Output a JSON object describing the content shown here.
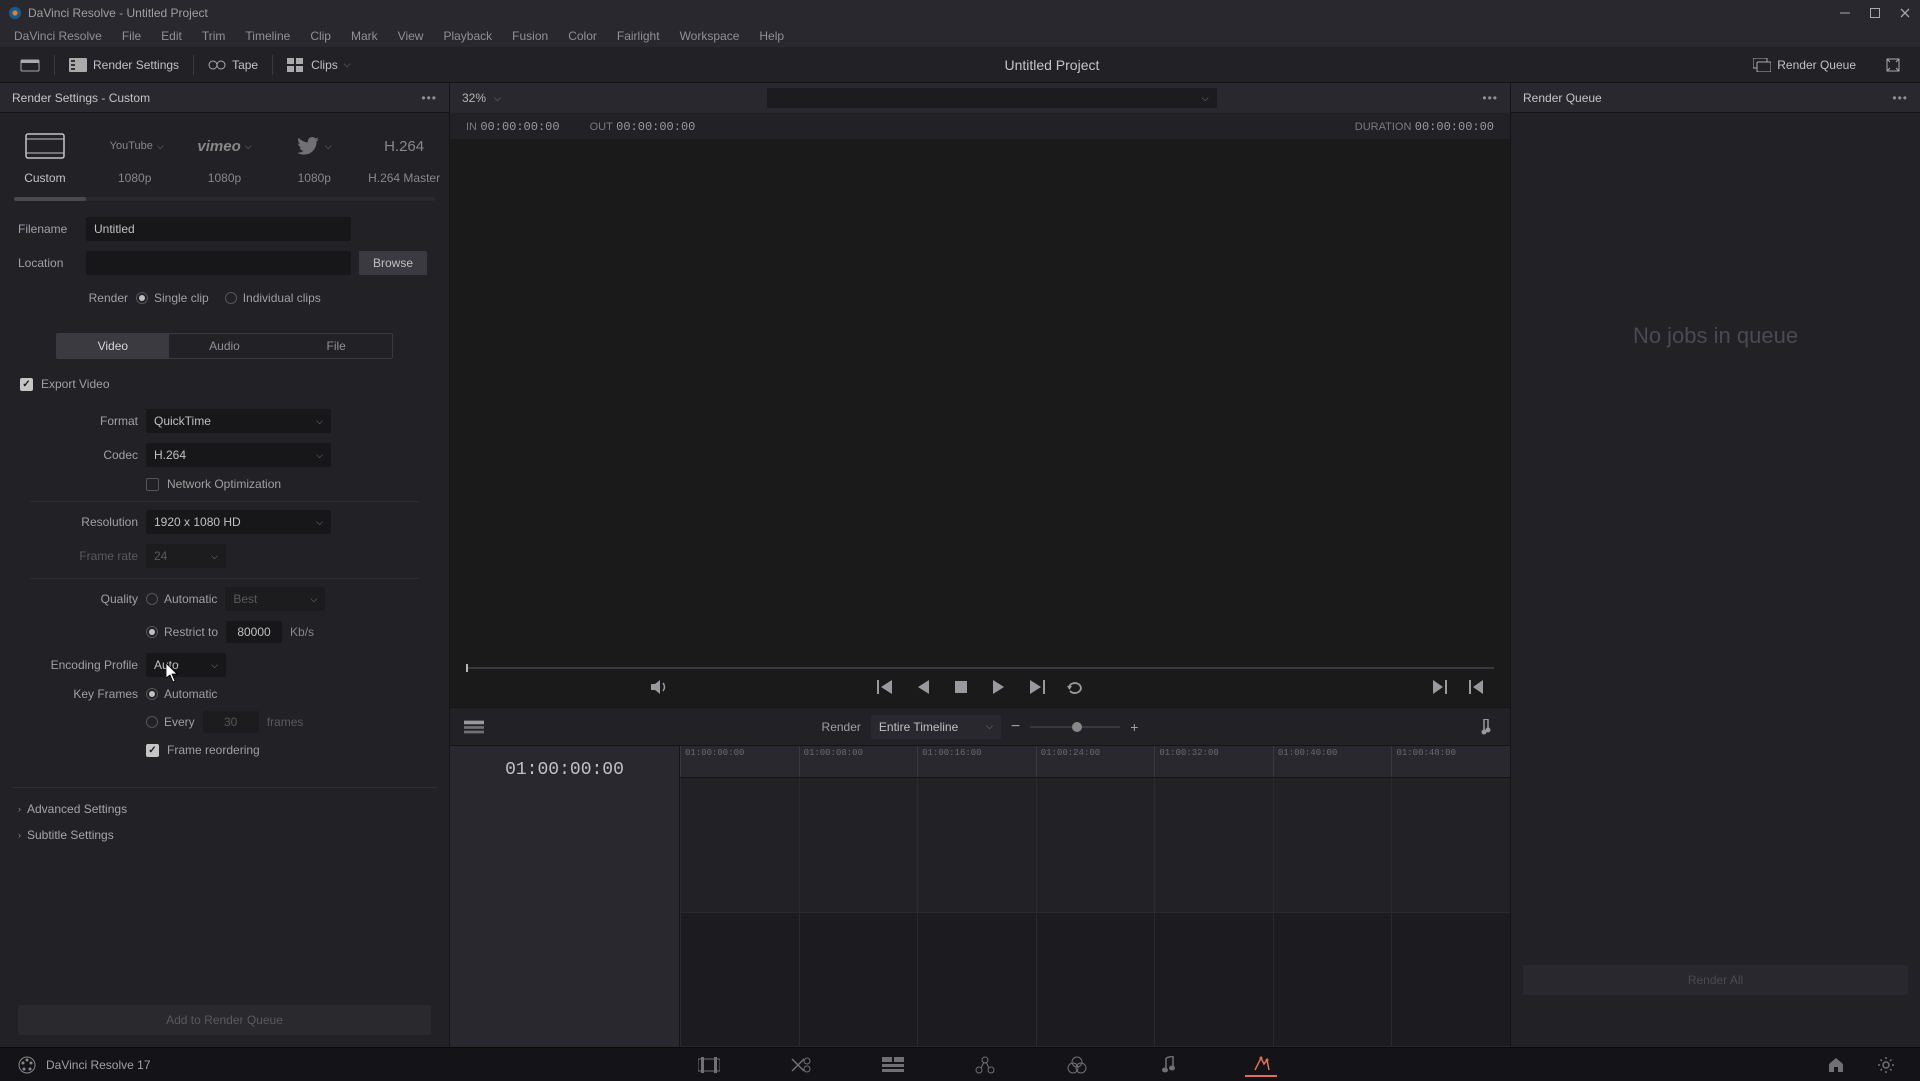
{
  "window": {
    "title": "DaVinci Resolve - Untitled Project"
  },
  "menu": [
    "DaVinci Resolve",
    "File",
    "Edit",
    "Trim",
    "Timeline",
    "Clip",
    "Mark",
    "View",
    "Playback",
    "Fusion",
    "Color",
    "Fairlight",
    "Workspace",
    "Help"
  ],
  "toolbar": {
    "render_settings": "Render Settings",
    "tape": "Tape",
    "clips": "Clips",
    "project_title": "Untitled Project",
    "render_queue": "Render Queue"
  },
  "left": {
    "header": "Render Settings - Custom",
    "presets": [
      {
        "key": "custom",
        "label": "Custom"
      },
      {
        "key": "youtube",
        "label": "1080p",
        "brand": "YouTube"
      },
      {
        "key": "vimeo",
        "label": "1080p",
        "brand": "vimeo"
      },
      {
        "key": "twitter",
        "label": "1080p"
      },
      {
        "key": "h264",
        "label": "H.264 Master",
        "brand": "H.264"
      }
    ],
    "filename_label": "Filename",
    "filename_value": "Untitled",
    "location_label": "Location",
    "location_value": "",
    "browse": "Browse",
    "render_label": "Render",
    "render_single": "Single clip",
    "render_individual": "Individual clips",
    "tabs": {
      "video": "Video",
      "audio": "Audio",
      "file": "File"
    },
    "export_video": "Export Video",
    "format_label": "Format",
    "format_value": "QuickTime",
    "codec_label": "Codec",
    "codec_value": "H.264",
    "network_opt": "Network Optimization",
    "resolution_label": "Resolution",
    "resolution_value": "1920 x 1080 HD",
    "framerate_label": "Frame rate",
    "framerate_value": "24",
    "quality_label": "Quality",
    "quality_auto": "Automatic",
    "quality_best": "Best",
    "quality_restrict": "Restrict to",
    "quality_bitrate": "80000",
    "quality_unit": "Kb/s",
    "encoding_label": "Encoding Profile",
    "encoding_value": "Auto",
    "keyframes_label": "Key Frames",
    "keyframes_auto": "Automatic",
    "keyframes_every": "Every",
    "keyframes_num": "30",
    "keyframes_unit": "frames",
    "frame_reorder": "Frame reordering",
    "advanced": "Advanced Settings",
    "subtitle": "Subtitle Settings",
    "add_to_queue": "Add to Render Queue"
  },
  "viewer": {
    "zoom": "32%",
    "in_label": "IN",
    "in_val": "00:00:00:00",
    "out_label": "OUT",
    "out_val": "00:00:00:00",
    "dur_label": "DURATION",
    "dur_val": "00:00:00:00"
  },
  "timeline": {
    "render_label": "Render",
    "render_scope": "Entire Timeline",
    "tc": "01:00:00:00",
    "ticks": [
      "01:00:00:00",
      "01:00:08:00",
      "01:00:16:00",
      "01:00:24:00",
      "01:00:32:00",
      "01:00:40:00",
      "01:00:48:00"
    ]
  },
  "queue": {
    "header": "Render Queue",
    "empty": "No jobs in queue",
    "render_all": "Render All"
  },
  "bottom": {
    "app": "DaVinci Resolve 17"
  }
}
